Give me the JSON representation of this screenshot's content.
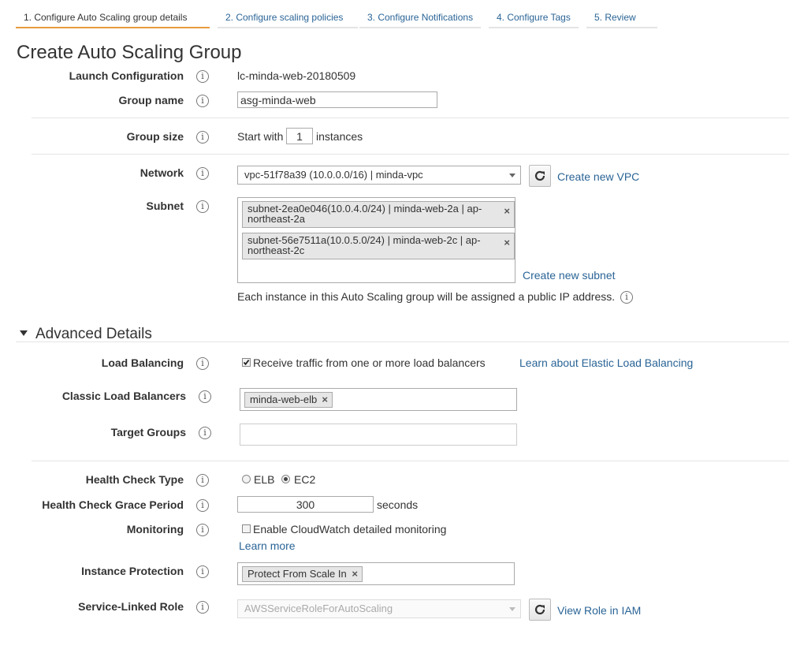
{
  "wizard": {
    "steps": [
      "1. Configure Auto Scaling group details",
      "2. Configure scaling policies",
      "3. Configure Notifications",
      "4. Configure Tags",
      "5. Review"
    ]
  },
  "page_title": "Create Auto Scaling Group",
  "launch_config": {
    "label": "Launch Configuration",
    "value": "lc-minda-web-20180509"
  },
  "group_name": {
    "label": "Group name",
    "value": "asg-minda-web"
  },
  "group_size": {
    "label": "Group size",
    "prefix": "Start with",
    "value": "1",
    "suffix": "instances"
  },
  "network": {
    "label": "Network",
    "value": "vpc-51f78a39 (10.0.0.0/16) | minda-vpc",
    "create_link": "Create new VPC"
  },
  "subnet": {
    "label": "Subnet",
    "items": [
      {
        "line1": "subnet-2ea0e046(10.0.4.0/24) | minda-web-2a | ap-",
        "line2": "northeast-2a"
      },
      {
        "line1": "subnet-56e7511a(10.0.5.0/24) | minda-web-2c | ap-",
        "line2": "northeast-2c"
      }
    ],
    "create_link": "Create new subnet",
    "note": "Each instance in this Auto Scaling group will be assigned a public IP address."
  },
  "advanced": {
    "title": "Advanced Details"
  },
  "load_balancing": {
    "label": "Load Balancing",
    "checkbox_label": "Receive traffic from one or more load balancers",
    "checked": true,
    "learn_link": "Learn about Elastic Load Balancing"
  },
  "classic_lb": {
    "label": "Classic Load Balancers",
    "chip": "minda-web-elb"
  },
  "target_groups": {
    "label": "Target Groups",
    "value": ""
  },
  "health_check_type": {
    "label": "Health Check Type",
    "options": [
      "ELB",
      "EC2"
    ],
    "selected": "EC2"
  },
  "grace_period": {
    "label": "Health Check Grace Period",
    "value": "300",
    "suffix": "seconds"
  },
  "monitoring": {
    "label": "Monitoring",
    "checkbox_label": "Enable CloudWatch detailed monitoring",
    "checked": false,
    "learn_link": "Learn more"
  },
  "instance_protection": {
    "label": "Instance Protection",
    "chip": "Protect From Scale In"
  },
  "service_role": {
    "label": "Service-Linked Role",
    "value": "AWSServiceRoleForAutoScaling",
    "view_link": "View Role in IAM"
  },
  "info_icon_glyph": "i",
  "chip_remove_glyph": "×",
  "colors": {
    "link": "#2a6496",
    "active_tab": "#e89a3c"
  }
}
